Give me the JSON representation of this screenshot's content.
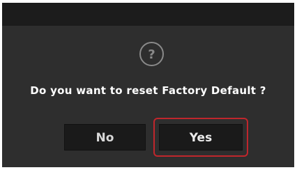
{
  "dialog": {
    "icon": "question-icon",
    "icon_glyph": "?",
    "message": "Do you want to reset Factory Default ?",
    "buttons": {
      "no_label": "No",
      "yes_label": "Yes"
    },
    "focused_button": "Yes",
    "colors": {
      "background": "#2e2e2e",
      "title_bar": "#1c1c1c",
      "button": "#1a1a1a",
      "focus_outline": "#c0262c",
      "text": "#ffffff"
    }
  }
}
